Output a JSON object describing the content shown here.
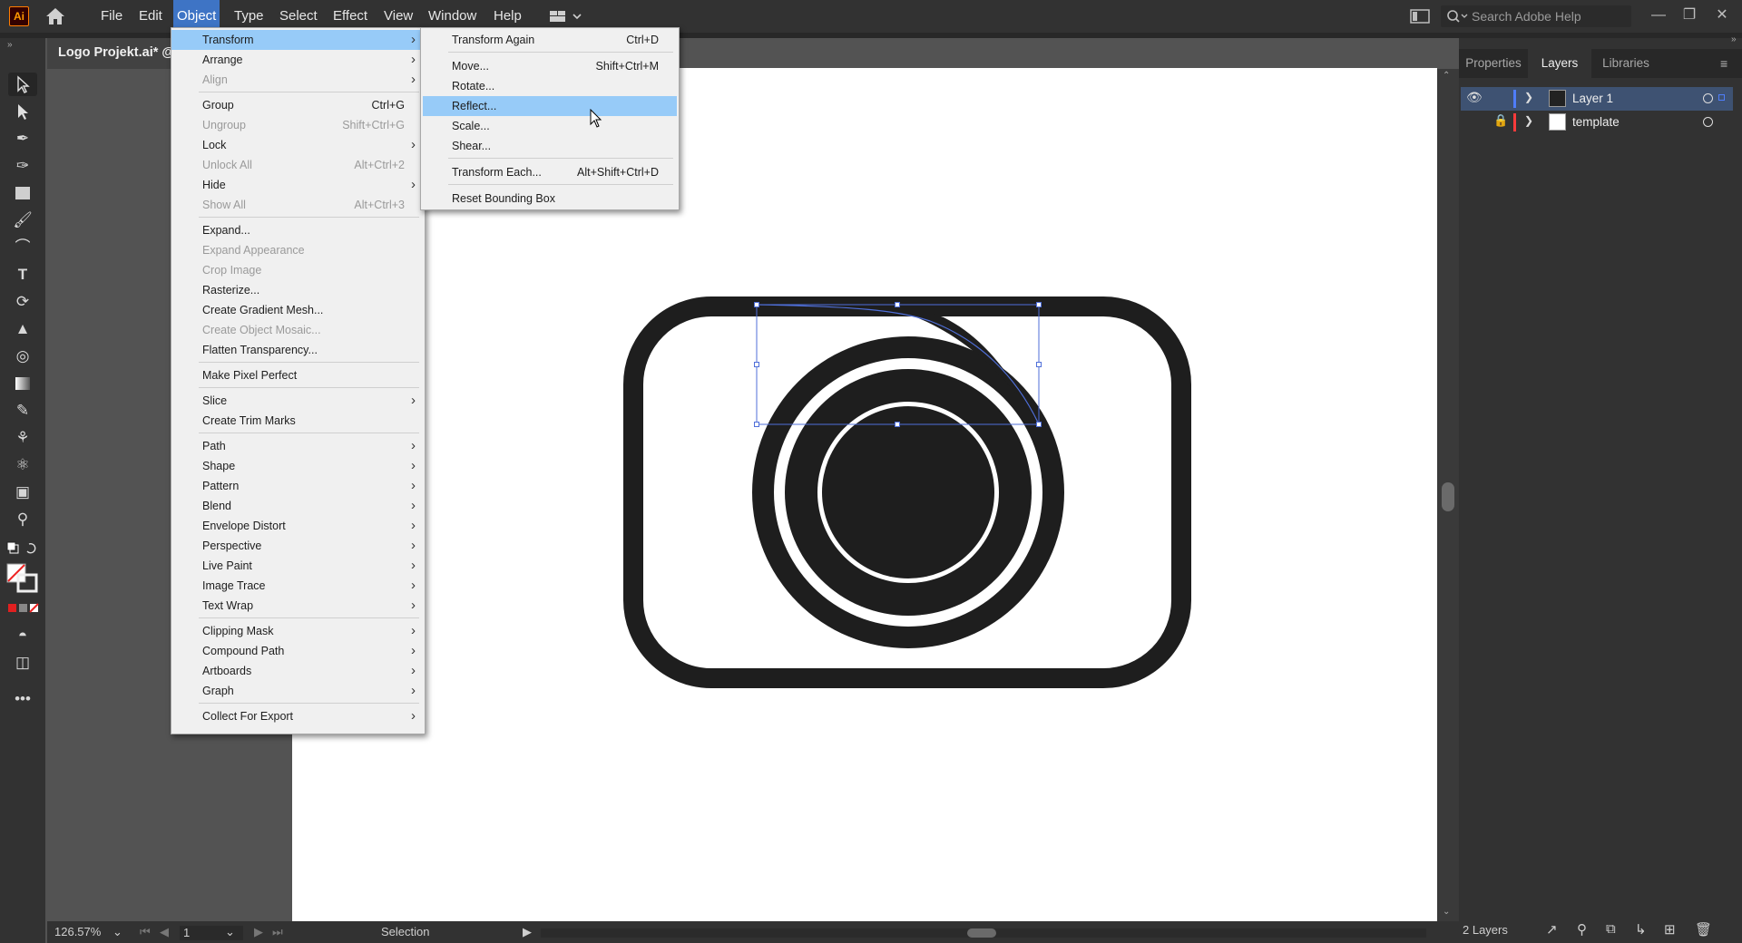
{
  "app": {
    "logo_text": "Ai",
    "menus": [
      "File",
      "Edit",
      "Object",
      "Type",
      "Select",
      "Effect",
      "View",
      "Window",
      "Help"
    ],
    "active_menu": "Object",
    "search_placeholder": "Search Adobe Help"
  },
  "document": {
    "tab_title": "Logo Projekt.ai* @"
  },
  "object_menu": {
    "items": [
      {
        "label": "Transform",
        "shortcut": "",
        "submenu": true,
        "disabled": false,
        "highlighted": true
      },
      {
        "label": "Arrange",
        "shortcut": "",
        "submenu": true,
        "disabled": false
      },
      {
        "label": "Align",
        "shortcut": "",
        "submenu": true,
        "disabled": true
      },
      {
        "label": "Group",
        "shortcut": "Ctrl+G",
        "submenu": false,
        "disabled": false
      },
      {
        "label": "Ungroup",
        "shortcut": "Shift+Ctrl+G",
        "submenu": false,
        "disabled": true
      },
      {
        "label": "Lock",
        "shortcut": "",
        "submenu": true,
        "disabled": false
      },
      {
        "label": "Unlock All",
        "shortcut": "Alt+Ctrl+2",
        "submenu": false,
        "disabled": true
      },
      {
        "label": "Hide",
        "shortcut": "",
        "submenu": true,
        "disabled": false
      },
      {
        "label": "Show All",
        "shortcut": "Alt+Ctrl+3",
        "submenu": false,
        "disabled": true
      },
      {
        "label": "Expand...",
        "shortcut": "",
        "submenu": false,
        "disabled": false
      },
      {
        "label": "Expand Appearance",
        "shortcut": "",
        "submenu": false,
        "disabled": true
      },
      {
        "label": "Crop Image",
        "shortcut": "",
        "submenu": false,
        "disabled": true
      },
      {
        "label": "Rasterize...",
        "shortcut": "",
        "submenu": false,
        "disabled": false
      },
      {
        "label": "Create Gradient Mesh...",
        "shortcut": "",
        "submenu": false,
        "disabled": false
      },
      {
        "label": "Create Object Mosaic...",
        "shortcut": "",
        "submenu": false,
        "disabled": true
      },
      {
        "label": "Flatten Transparency...",
        "shortcut": "",
        "submenu": false,
        "disabled": false
      },
      {
        "label": "Make Pixel Perfect",
        "shortcut": "",
        "submenu": false,
        "disabled": false
      },
      {
        "label": "Slice",
        "shortcut": "",
        "submenu": true,
        "disabled": false
      },
      {
        "label": "Create Trim Marks",
        "shortcut": "",
        "submenu": false,
        "disabled": false
      },
      {
        "label": "Path",
        "shortcut": "",
        "submenu": true,
        "disabled": false
      },
      {
        "label": "Shape",
        "shortcut": "",
        "submenu": true,
        "disabled": false
      },
      {
        "label": "Pattern",
        "shortcut": "",
        "submenu": true,
        "disabled": false
      },
      {
        "label": "Blend",
        "shortcut": "",
        "submenu": true,
        "disabled": false
      },
      {
        "label": "Envelope Distort",
        "shortcut": "",
        "submenu": true,
        "disabled": false
      },
      {
        "label": "Perspective",
        "shortcut": "",
        "submenu": true,
        "disabled": false
      },
      {
        "label": "Live Paint",
        "shortcut": "",
        "submenu": true,
        "disabled": false
      },
      {
        "label": "Image Trace",
        "shortcut": "",
        "submenu": true,
        "disabled": false
      },
      {
        "label": "Text Wrap",
        "shortcut": "",
        "submenu": true,
        "disabled": false
      },
      {
        "label": "Clipping Mask",
        "shortcut": "",
        "submenu": true,
        "disabled": false
      },
      {
        "label": "Compound Path",
        "shortcut": "",
        "submenu": true,
        "disabled": false
      },
      {
        "label": "Artboards",
        "shortcut": "",
        "submenu": true,
        "disabled": false
      },
      {
        "label": "Graph",
        "shortcut": "",
        "submenu": true,
        "disabled": false
      },
      {
        "label": "Collect For Export",
        "shortcut": "",
        "submenu": true,
        "disabled": false
      }
    ]
  },
  "transform_submenu": {
    "items": [
      {
        "label": "Transform Again",
        "shortcut": "Ctrl+D"
      },
      {
        "label": "Move...",
        "shortcut": "Shift+Ctrl+M"
      },
      {
        "label": "Rotate...",
        "shortcut": ""
      },
      {
        "label": "Reflect...",
        "shortcut": "",
        "highlighted": true
      },
      {
        "label": "Scale...",
        "shortcut": ""
      },
      {
        "label": "Shear...",
        "shortcut": ""
      },
      {
        "label": "Transform Each...",
        "shortcut": "Alt+Shift+Ctrl+D"
      },
      {
        "label": "Reset Bounding Box",
        "shortcut": ""
      }
    ]
  },
  "right_panel": {
    "tabs": [
      "Properties",
      "Layers",
      "Libraries"
    ],
    "active_tab": "Layers",
    "layers": [
      {
        "name": "Layer 1",
        "color": "#4f7df9",
        "selected": true,
        "visible": true,
        "locked": false
      },
      {
        "name": "template",
        "color": "#ff3b3b",
        "selected": false,
        "visible": false,
        "locked": true
      }
    ],
    "layer_count": "2 Layers"
  },
  "status": {
    "zoom": "126.57%",
    "artboard_number": "1",
    "tool_name": "Selection"
  },
  "colors": {
    "selection": "#4f6fd9",
    "menu_highlight": "#97cbf8",
    "artwork": "#1e1e1e"
  }
}
